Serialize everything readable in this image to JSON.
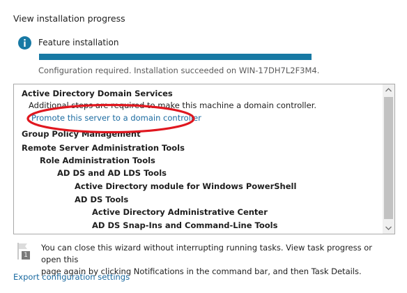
{
  "header": {
    "title": "View installation progress"
  },
  "progress": {
    "title": "Feature installation",
    "fraction": 1.0,
    "status": "Configuration required. Installation succeeded on WIN-17DH7L2F3M4."
  },
  "results": {
    "items": [
      {
        "text": "Active Directory Domain Services",
        "bold": true
      },
      {
        "text": "Additional steps are required to make this machine a domain controller.",
        "bold": false
      },
      {
        "text": "Promote this server to a domain controller",
        "link": true
      },
      {
        "text": "Group Policy Management",
        "bold": true
      },
      {
        "text": "Remote Server Administration Tools",
        "bold": true
      },
      {
        "text": "Role Administration Tools",
        "bold": true
      },
      {
        "text": "AD DS and AD LDS Tools",
        "bold": true
      },
      {
        "text": "Active Directory module for Windows PowerShell",
        "bold": true
      },
      {
        "text": "AD DS Tools",
        "bold": true
      },
      {
        "text": "Active Directory Administrative Center",
        "bold": true
      },
      {
        "text": "AD DS Snap-Ins and Command-Line Tools",
        "bold": true
      }
    ]
  },
  "footer": {
    "note_line1": "You can close this wizard without interrupting running tasks. View task progress or open this",
    "note_line2": "page again by clicking Notifications in the command bar, and then Task Details.",
    "flag_badge": "1",
    "export_link": "Export configuration settings"
  },
  "colors": {
    "accent": "#1779a4",
    "link": "#1a6aa0",
    "annotation": "#e0171f"
  }
}
